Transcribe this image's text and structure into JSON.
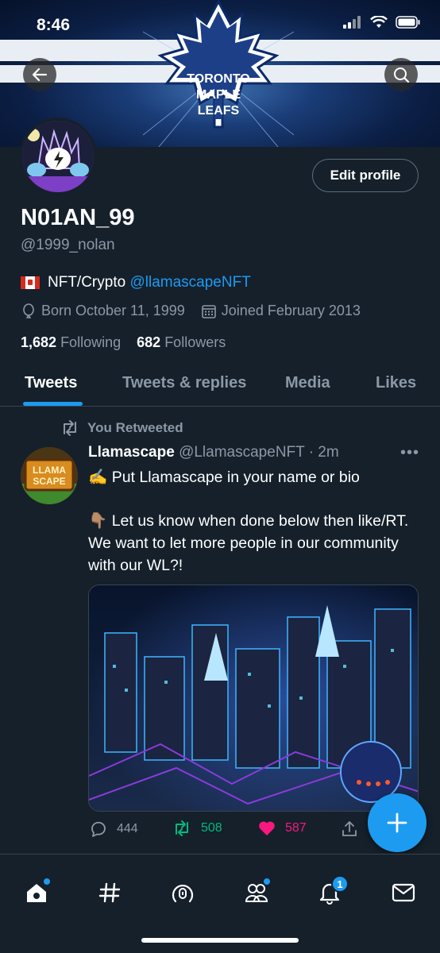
{
  "status_bar": {
    "time": "8:46"
  },
  "banner": {
    "logo_text": [
      "TORONTO",
      "MAPLE",
      "LEAFS"
    ]
  },
  "profile": {
    "edit_label": "Edit profile",
    "name": "N01AN_99",
    "handle": "@1999_nolan",
    "bio_text": "NFT/Crypto",
    "bio_link": "@llamascapeNFT",
    "born": "Born October 11, 1999",
    "joined": "Joined February 2013",
    "following_count": "1,682",
    "following_label": "Following",
    "followers_count": "682",
    "followers_label": "Followers"
  },
  "tabs": [
    {
      "label": "Tweets",
      "active": true
    },
    {
      "label": "Tweets & replies",
      "active": false
    },
    {
      "label": "Media",
      "active": false
    },
    {
      "label": "Likes",
      "active": false
    }
  ],
  "tweet": {
    "retweet_label": "You Retweeted",
    "author_name": "Llamascape",
    "author_handle": "@LlamascapeNFT",
    "time": "· 2m",
    "avatar_text": [
      "LLAMA",
      "SCAPE"
    ],
    "line1": "✍️ Put Llamascape in your name or bio",
    "line2": "👇🏽 Let us know when done below then like/RT. We want to let more people in our community with our WL?!",
    "replies": "444",
    "retweets": "508",
    "likes": "587"
  },
  "bottom_nav": {
    "notifications_badge": "1"
  },
  "colors": {
    "background": "#15202b",
    "accent": "#1d9bf0",
    "retweet": "#00ba7c",
    "like": "#f91880",
    "muted": "#8b98a5"
  }
}
